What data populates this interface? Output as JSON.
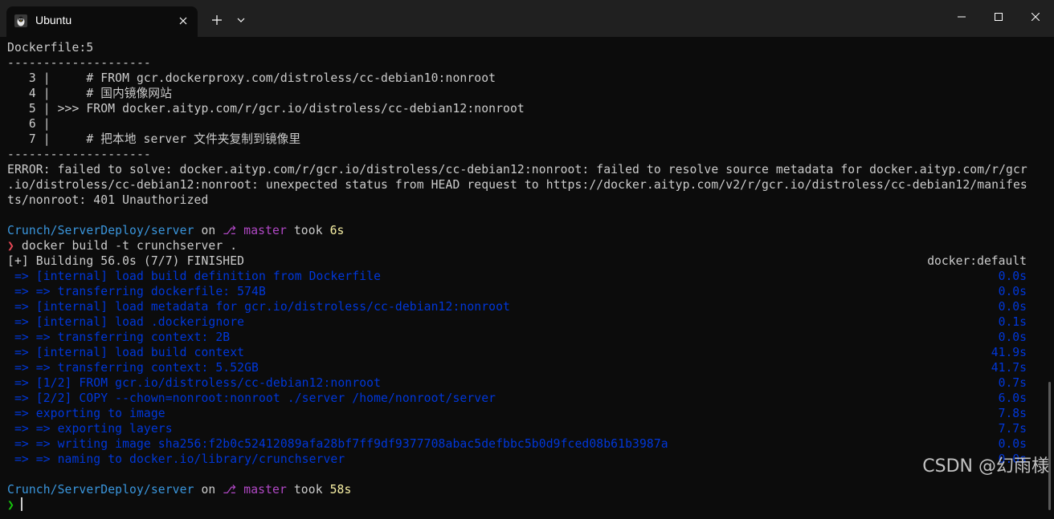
{
  "window": {
    "tab_title": "Ubuntu",
    "icons": {
      "tab": "linux-penguin-icon",
      "close_tab": "close-icon",
      "new_tab": "plus-icon",
      "dropdown": "chevron-down-icon",
      "minimize": "minimize-icon",
      "maximize": "maximize-icon",
      "close_window": "close-icon"
    }
  },
  "colors": {
    "background": "#0c0c0c",
    "titlebar": "#202020",
    "text": "#cccccc",
    "build_blue": "#0037da",
    "path": "#3a96dd",
    "branch": "#b148c6",
    "duration": "#f9f1a5",
    "prompt_error": "#e74856",
    "prompt_ok": "#16c60c"
  },
  "terminal": {
    "dockerfile_header": "Dockerfile:5",
    "separator": "--------------------",
    "source_lines": [
      "   3 |     # FROM gcr.dockerproxy.com/distroless/cc-debian10:nonroot",
      "   4 |     # 国内镜像网站",
      "   5 | >>> FROM docker.aityp.com/r/gcr.io/distroless/cc-debian12:nonroot",
      "   6 |",
      "   7 |     # 把本地 server 文件夹复制到镜像里"
    ],
    "error_lines": [
      "ERROR: failed to solve: docker.aityp.com/r/gcr.io/distroless/cc-debian12:nonroot: failed to resolve source metadata for docker.aityp.com/r/gcr",
      ".io/distroless/cc-debian12:nonroot: unexpected status from HEAD request to https://docker.aityp.com/v2/r/gcr.io/distroless/cc-debian12/manifes",
      "ts/nonroot: 401 Unauthorized"
    ],
    "prompt1": {
      "path": "Crunch/ServerDeploy/server",
      "on": " on ",
      "branch": "⎇ master",
      "took": " took ",
      "duration": "6s"
    },
    "command": {
      "symbol": "❯",
      "text": " docker build -t crunchserver ."
    },
    "build_header": {
      "left": "[+] Building 56.0s (7/7) FINISHED",
      "right": "docker:default"
    },
    "build_steps": [
      {
        "text": " => [internal] load build definition from Dockerfile",
        "time": "0.0s"
      },
      {
        "text": " => => transferring dockerfile: 574B",
        "time": "0.0s"
      },
      {
        "text": " => [internal] load metadata for gcr.io/distroless/cc-debian12:nonroot",
        "time": "0.0s"
      },
      {
        "text": " => [internal] load .dockerignore",
        "time": "0.1s"
      },
      {
        "text": " => => transferring context: 2B",
        "time": "0.0s"
      },
      {
        "text": " => [internal] load build context",
        "time": "41.9s"
      },
      {
        "text": " => => transferring context: 5.52GB",
        "time": "41.7s"
      },
      {
        "text": " => [1/2] FROM gcr.io/distroless/cc-debian12:nonroot",
        "time": "0.7s"
      },
      {
        "text": " => [2/2] COPY --chown=nonroot:nonroot ./server /home/nonroot/server",
        "time": "6.0s"
      },
      {
        "text": " => exporting to image",
        "time": "7.8s"
      },
      {
        "text": " => => exporting layers",
        "time": "7.7s"
      },
      {
        "text": " => => writing image sha256:f2b0c52412089afa28bf7ff9df9377708abac5defbbc5b0d9fced08b61b3987a",
        "time": "0.0s"
      },
      {
        "text": " => => naming to docker.io/library/crunchserver",
        "time": "0.0s"
      }
    ],
    "prompt2": {
      "path": "Crunch/ServerDeploy/server",
      "on": " on ",
      "branch": "⎇ master",
      "took": " took ",
      "duration": "58s"
    },
    "prompt_symbol": "❯"
  },
  "watermark": "CSDN @幻雨様"
}
